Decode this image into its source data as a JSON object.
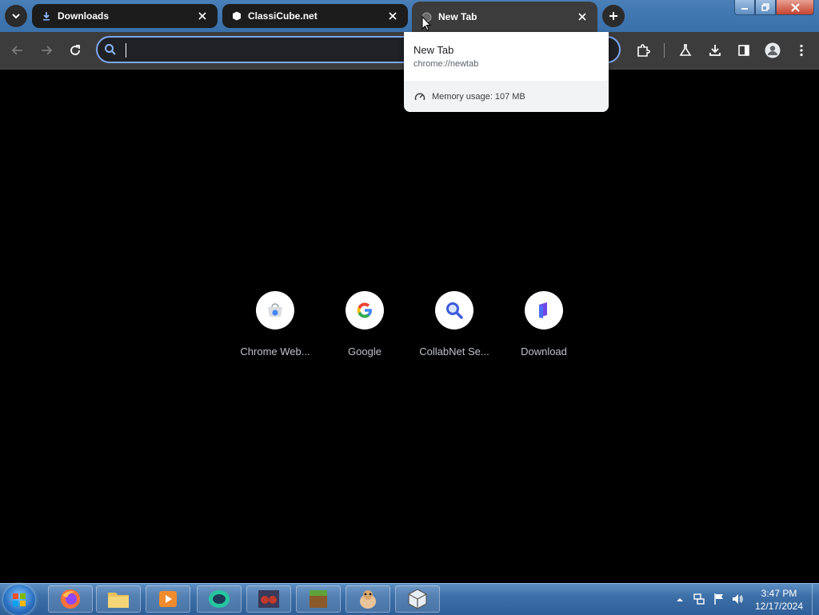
{
  "tabs": [
    {
      "label": "Downloads",
      "icon": "download-icon"
    },
    {
      "label": "ClassiCube.net",
      "icon": "cube-icon"
    },
    {
      "label": "New Tab",
      "icon": "globe-icon",
      "active": true
    }
  ],
  "omnibox": {
    "value": "",
    "placeholder": ""
  },
  "hovercard": {
    "title": "New Tab",
    "url": "chrome://newtab",
    "memory": "Memory usage: 107 MB"
  },
  "shortcuts": [
    {
      "label": "Chrome Web...",
      "icon": "chrome-web-store-icon"
    },
    {
      "label": "Google",
      "icon": "google-icon"
    },
    {
      "label": "CollabNet Se...",
      "icon": "magnifier-icon"
    },
    {
      "label": "Download",
      "icon": "download-site-icon"
    }
  ],
  "taskbar": {
    "apps": [
      "firefox",
      "file-explorer",
      "media-player",
      "chat-app",
      "game-app",
      "minecraft",
      "mascot-app",
      "cube-app"
    ],
    "clock_time": "3:47 PM",
    "clock_date": "12/17/2024"
  },
  "colors": {
    "accent": "#7ca7f5",
    "toolbar": "#3c3c3c",
    "tab_inactive": "#1c1c1c",
    "background": "#000000"
  }
}
